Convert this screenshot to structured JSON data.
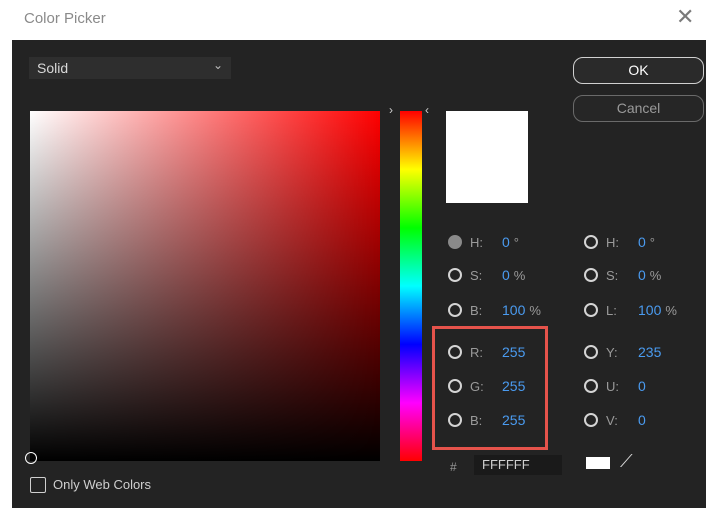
{
  "window": {
    "title": "Color Picker",
    "close_glyph": "✕"
  },
  "mode_dropdown": {
    "value": "Solid",
    "chevron_icon": "chevron-down-icon"
  },
  "buttons": {
    "ok": "OK",
    "cancel": "Cancel"
  },
  "current_color_hex": "#ffffff",
  "left_fields": [
    {
      "label": "H:",
      "value": "0",
      "unit": "°",
      "selected": true
    },
    {
      "label": "S:",
      "value": "0",
      "unit": "%",
      "selected": false
    },
    {
      "label": "B:",
      "value": "100",
      "unit": "%",
      "selected": false
    },
    {
      "label": "R:",
      "value": "255",
      "unit": "",
      "selected": false
    },
    {
      "label": "G:",
      "value": "255",
      "unit": "",
      "selected": false
    },
    {
      "label": "B:",
      "value": "255",
      "unit": "",
      "selected": false
    }
  ],
  "right_fields": [
    {
      "label": "H:",
      "value": "0",
      "unit": "°"
    },
    {
      "label": "S:",
      "value": "0",
      "unit": "%"
    },
    {
      "label": "L:",
      "value": "100",
      "unit": "%"
    },
    {
      "label": "Y:",
      "value": "235",
      "unit": ""
    },
    {
      "label": "U:",
      "value": "0",
      "unit": ""
    },
    {
      "label": "V:",
      "value": "0",
      "unit": ""
    }
  ],
  "hex": {
    "prefix": "#",
    "value": "FFFFFF"
  },
  "web_colors": {
    "label": "Only Web Colors",
    "checked": false
  },
  "colors": {
    "panel_bg": "#232323",
    "value_blue": "#4a9bf0",
    "highlight_red": "#e5534b"
  },
  "icons": {
    "eyedropper": "eyedropper-icon",
    "close": "close-icon"
  }
}
